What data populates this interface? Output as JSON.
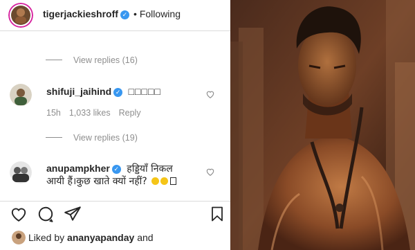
{
  "post": {
    "author": "tigerjackieshroff",
    "separator": "•",
    "follow_status": "Following"
  },
  "thread": {
    "view_replies_1": "View replies (16)",
    "view_replies_2": "View replies (19)"
  },
  "comments": [
    {
      "username": "shifuji_jaihind",
      "text": "□□□□□",
      "age": "15h",
      "likes": "1,033 likes",
      "reply": "Reply"
    },
    {
      "username": "anupampkher",
      "text_line1": "हड्डियाँ निकल",
      "text_line2": "आयी हैं।कुछ खाते क्यों नहीं?"
    }
  ],
  "likes_bar": {
    "prefix": "Liked by",
    "user": "ananyapanday",
    "suffix": "and"
  },
  "colors": {
    "verified": "#3897f0",
    "muted": "#8e8e8e",
    "text": "#262626",
    "divider": "#dbdbdb"
  },
  "icons": [
    "heart-icon",
    "comment-icon",
    "share-icon",
    "bookmark-icon",
    "verified-badge-icon"
  ]
}
